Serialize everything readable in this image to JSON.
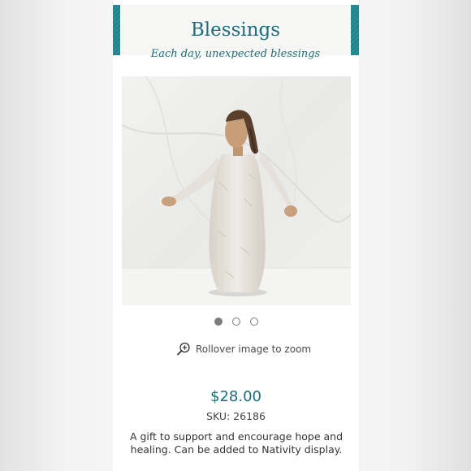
{
  "product": {
    "title": "Blessings",
    "subtitle": "Each day, unexpected blessings",
    "image_alt": "Blessings figurine",
    "price": "$28.00",
    "sku": "SKU: 26186",
    "description": "A gift to support and encourage hope and healing. Can be added to Nativity display."
  },
  "carousel": {
    "slide_count": 3,
    "active_index": 0
  },
  "zoom": {
    "label": "Rollover image to zoom",
    "icon": "magnifier-plus-icon"
  },
  "colors": {
    "accent": "#1e6d78",
    "header_texture": "#24838c",
    "dot_active": "#7d7d7d"
  }
}
